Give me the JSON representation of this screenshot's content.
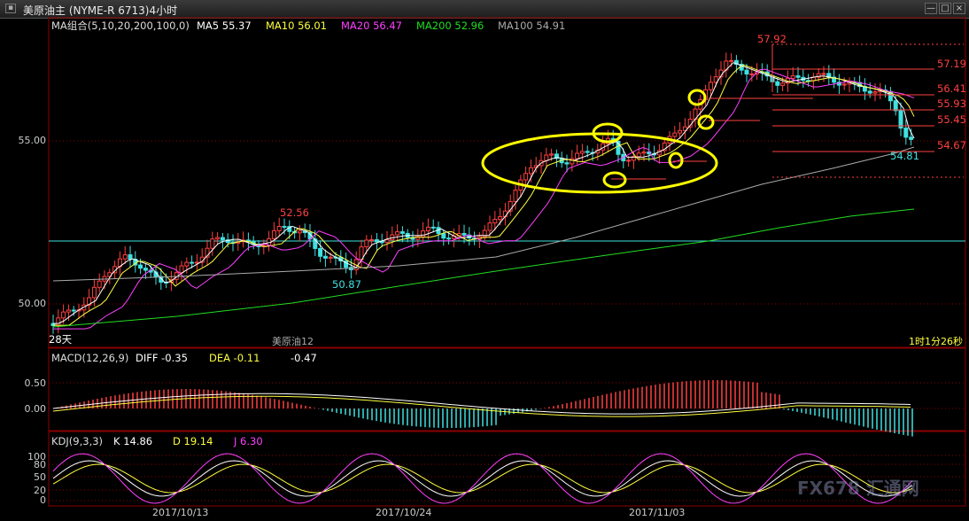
{
  "window": {
    "title": "美原油主 (NYME-R 6713)4小时",
    "controls": [
      "—",
      "□",
      "×"
    ]
  },
  "legend": {
    "combo": "MA组合(5,10,20,200,100,0)",
    "ma5": "MA5 55.37",
    "ma10": "MA10 56.01",
    "ma20": "MA20 56.47",
    "ma200": "MA200 52.96",
    "ma100": "MA100 54.91"
  },
  "colors": {
    "ma5": "#ffffff",
    "ma10": "#ffff40",
    "ma20": "#ff40ff",
    "ma200": "#22dd22",
    "ma100": "#aaaaaa",
    "up": "#ff4040",
    "down": "#40e0e0",
    "grid": "#8b0000",
    "label_red": "#ff4040",
    "label_cyan": "#40e0e0",
    "annotation": "#ffff00",
    "hline": "#40e0e0"
  },
  "price_axis": {
    "ticks": [
      "55.00",
      "50.00"
    ]
  },
  "annotations": {
    "high": "57.92",
    "levels": [
      "57.19",
      "56.41",
      "55.93",
      "55.45",
      "54.67"
    ],
    "last": "54.81",
    "swing_high": "52.56",
    "swing_low": "50.87",
    "days": "28天",
    "contract": "美原油12",
    "countdown": "1时1分26秒"
  },
  "macd": {
    "label": "MACD(12,26,9)",
    "diff": "DIFF  -0.35",
    "dea": "DEA  -0.11",
    "macd": "-0.47",
    "ticks": [
      "0.50",
      "0.00"
    ]
  },
  "kdj": {
    "label": "KDJ(9,3,3)",
    "k": "K  14.86",
    "d": "D  19.14",
    "j": "J  6.30",
    "ticks": [
      "100",
      "80",
      "50",
      "20",
      "0"
    ]
  },
  "xaxis": {
    "dates": [
      "2017/10/13",
      "2017/10/24",
      "2017/11/03"
    ]
  },
  "watermark": "FX678 汇通网"
}
